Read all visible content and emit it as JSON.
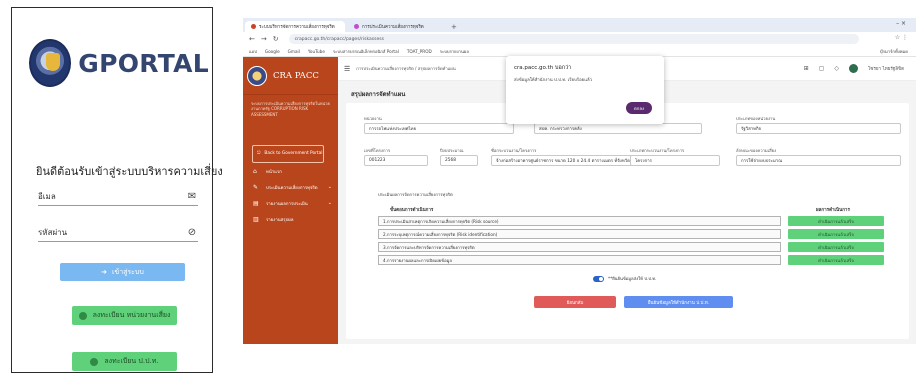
{
  "phone": {
    "logo_text": "GPORTAL",
    "welcome": "ยินดีต้อนรับเข้าสู่ระบบบริหารความเสี่ยง",
    "email_label": "อีเมล",
    "password_label": "รหัสผ่าน",
    "login_button": "เข้าสู่ระบบ",
    "register_button_1": "ลงทะเบียน หน่วยงานเสี่ยง",
    "register_button_2": "ลงทะเบียน ป.ป.ท."
  },
  "browser": {
    "tabs": [
      {
        "label": "ระบบบริหารจัดการความเสี่ยงการทุจริต"
      },
      {
        "label": "การประเมินความเสี่ยงการทุจริต"
      }
    ],
    "new_tab": "+",
    "window_controls": "–   ×",
    "url": "crapacc.go.th/crapacc/pages/riskassess",
    "bookmarks": [
      "แอป",
      "Google",
      "Gmail",
      "YouTube",
      "ระบบสารบรรณอิเล็กทรอนิกส์ Portal",
      "TOAT_PROD",
      "ระบบรายงานผล",
      "บุ๊กมาร์กอื่นๆ"
    ],
    "all_bookmarks": "บุ๊กมาร์กทั้งหมด"
  },
  "sidebar": {
    "brand": "CRA PACC",
    "description": "ระบบการประเมินความเสี่ยงการทุจริตในหน่วยงานภาครัฐ CORRUPTION RISK ASSESSMENT",
    "back_button": "Back to Government Portal",
    "items": [
      {
        "label": "หน้าแรก",
        "icon": "home-icon",
        "glyph": "⌂"
      },
      {
        "label": "ประเมินความเสี่ยงการทุจริต",
        "icon": "edit-icon",
        "glyph": "✎"
      },
      {
        "label": "รายงานผลการประเมิน",
        "icon": "document-icon",
        "glyph": "▤"
      },
      {
        "label": "รายงานสรุปผล",
        "icon": "chart-icon",
        "glyph": "▥"
      }
    ]
  },
  "topnav": {
    "breadcrumb": "การประเมินความเสี่ยงการทุจริต / สรุปผลการจัดทำแผน",
    "user_name": "โซรยา ไทยรัฐลิขิต"
  },
  "page": {
    "title": "สรุปผลการจัดทำแผน",
    "fields": {
      "agency_label": "หน่วยงาน",
      "agency_value": "การรถไฟแห่งประเทศไทย",
      "province_label": "สังกัด / กระทรวง",
      "province_value": "สปค. กระทรวงการคลัง",
      "type_label": "ประเภทของหน่วยงาน",
      "type_value": "รัฐวิสาหกิจ",
      "project_no_label": "เลขที่โครงการ",
      "project_no_value": "001223",
      "year_label": "ปีงบประมาณ",
      "year_value": "2568",
      "project_name_label": "ชื่อกระบวนงาน/โครงการ",
      "project_name_value": "จ้างก่อสร้างอาคารศูนย์ราชการ ขนาด 120 x 24.4 ตารางเมตร ที่จังหวัด",
      "category_label": "ประเภทกระบวนงาน/โครงการ",
      "category_value": "โครงการ",
      "risk_label": "ลักษณะของความเสี่ยง",
      "risk_value": "การใช้จ่ายงบประมาณ"
    },
    "subsection_title": "ประเมินผลการจัดการความเสี่ยงการทุจริต",
    "table_head_left": "ขั้นตอนการดำเนินการ",
    "table_head_right": "ผลการดำเนินการ",
    "rows": [
      {
        "step": "1.การประเมินสาเหตุการเกิดความเสี่ยงการทุจริต (Risk source)",
        "status": "ดำเนินการแล้วเสร็จ"
      },
      {
        "step": "2.การระบุเหตุการณ์ความเสี่ยงการทุจริต (Risk identification)",
        "status": "ดำเนินการแล้วเสร็จ"
      },
      {
        "step": "3.การจัดการและบริหารจัดการความเสี่ยงการทุจริต",
        "status": "ดำเนินการแล้วเสร็จ"
      },
      {
        "step": "4.การรายงานผลและการเปิดเผยข้อมูล",
        "status": "ดำเนินการแล้วเสร็จ"
      }
    ],
    "toggle_label": "**ยืนยันข้อมูลส่งให้ ป.ป.ท.",
    "cancel_button": "ย้อนกลับ",
    "submit_button": "ยืนยันข้อมูลให้สำนักงาน ป.ป.ท."
  },
  "dialog": {
    "title": "cra.pacc.go.th บอกว่า",
    "message": "ส่งข้อมูลให้สำนักงาน ป.ป.ท. เรียบร้อยแล้ว",
    "ok_label": "ตกลง"
  },
  "colors": {
    "sidebar": "#b9451c",
    "success": "#5fd17a",
    "primary": "#5f8ef0",
    "danger": "#e05a5a",
    "login": "#79b8f0"
  }
}
